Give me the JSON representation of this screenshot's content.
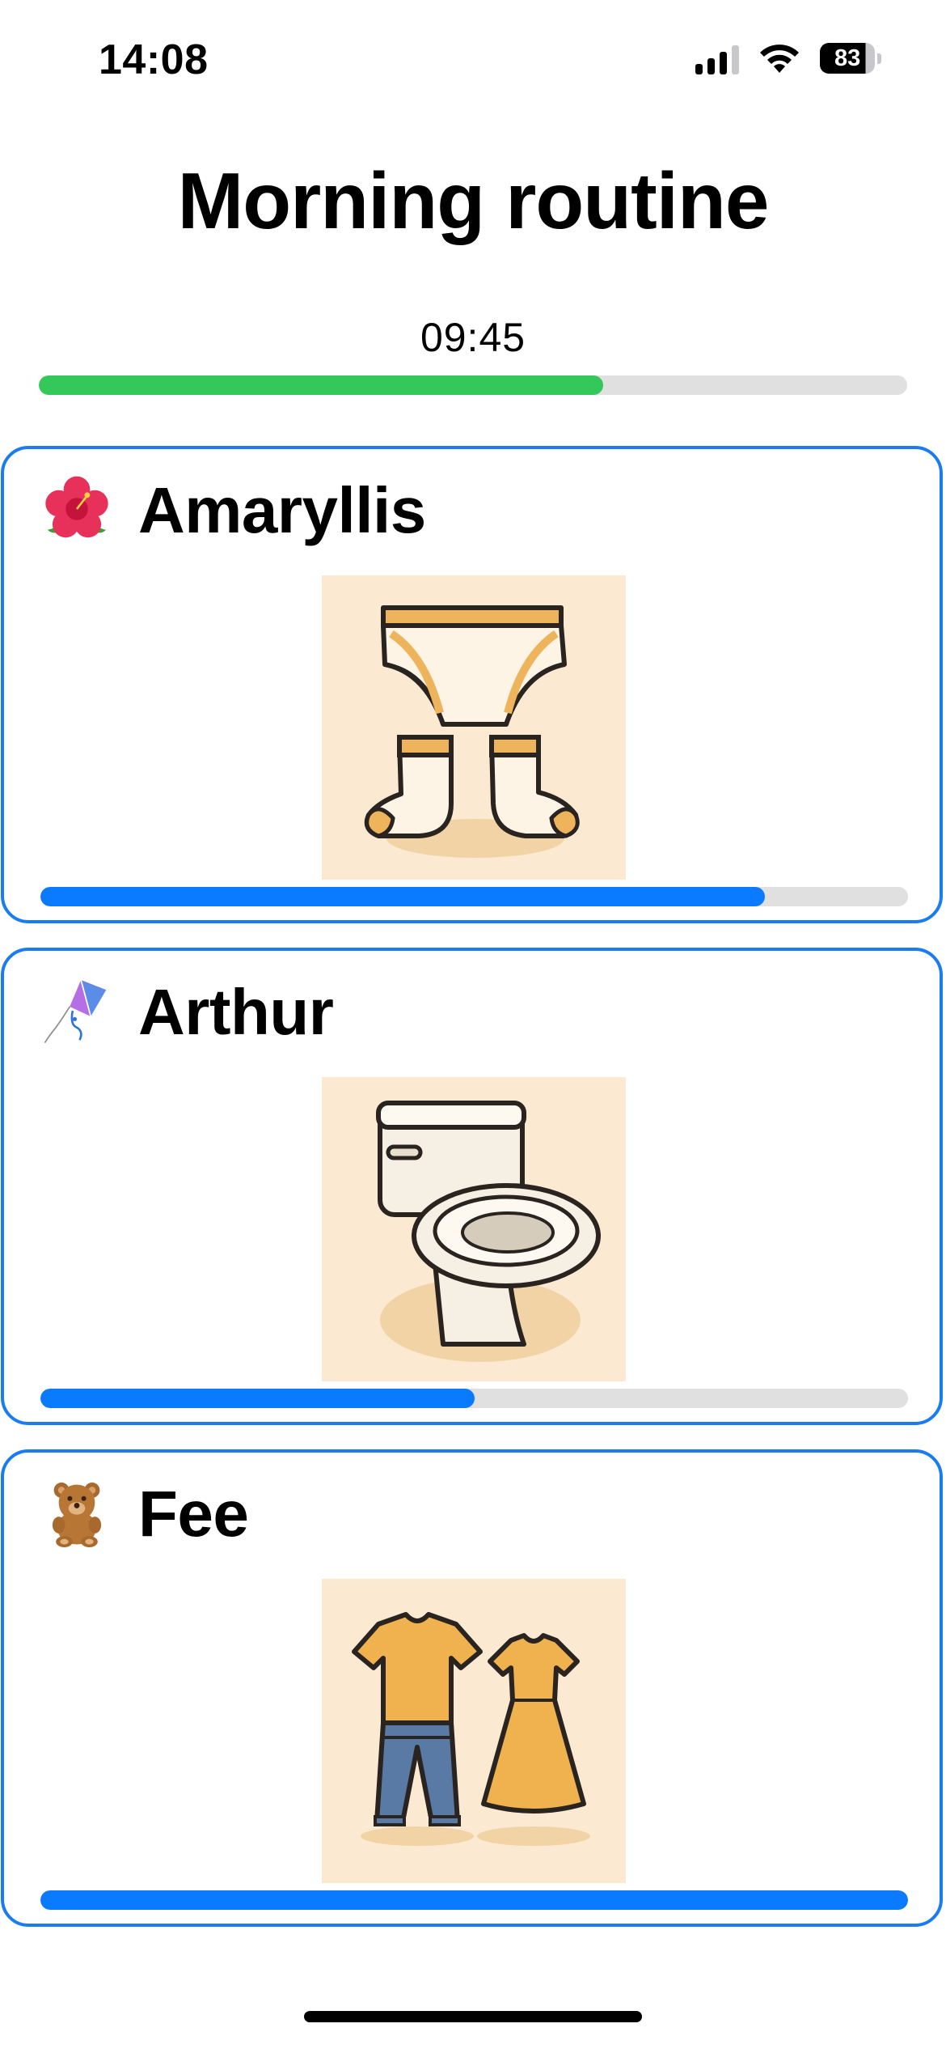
{
  "status_bar": {
    "time": "14:08",
    "battery": "83",
    "battery_level": 0.83,
    "icons": [
      "cellular-signal-icon",
      "wifi-icon",
      "battery-icon"
    ]
  },
  "header": {
    "title": "Morning routine",
    "timer": "09:45",
    "progress": 0.65,
    "progress_color": "#34c759"
  },
  "children": [
    {
      "name": "Amaryllis",
      "emoji": "hibiscus-icon",
      "task_icon": "underwear-and-socks-icon",
      "progress": 0.835
    },
    {
      "name": "Arthur",
      "emoji": "kite-icon",
      "task_icon": "toilet-icon",
      "progress": 0.5
    },
    {
      "name": "Fee",
      "emoji": "teddy-bear-icon",
      "task_icon": "clothes-icon",
      "progress": 1.0
    }
  ],
  "colors": {
    "card_border": "#1a7cf0",
    "child_progress": "#0a7aff",
    "track": "#e0e0e0",
    "task_background": "#fbe9d2"
  }
}
